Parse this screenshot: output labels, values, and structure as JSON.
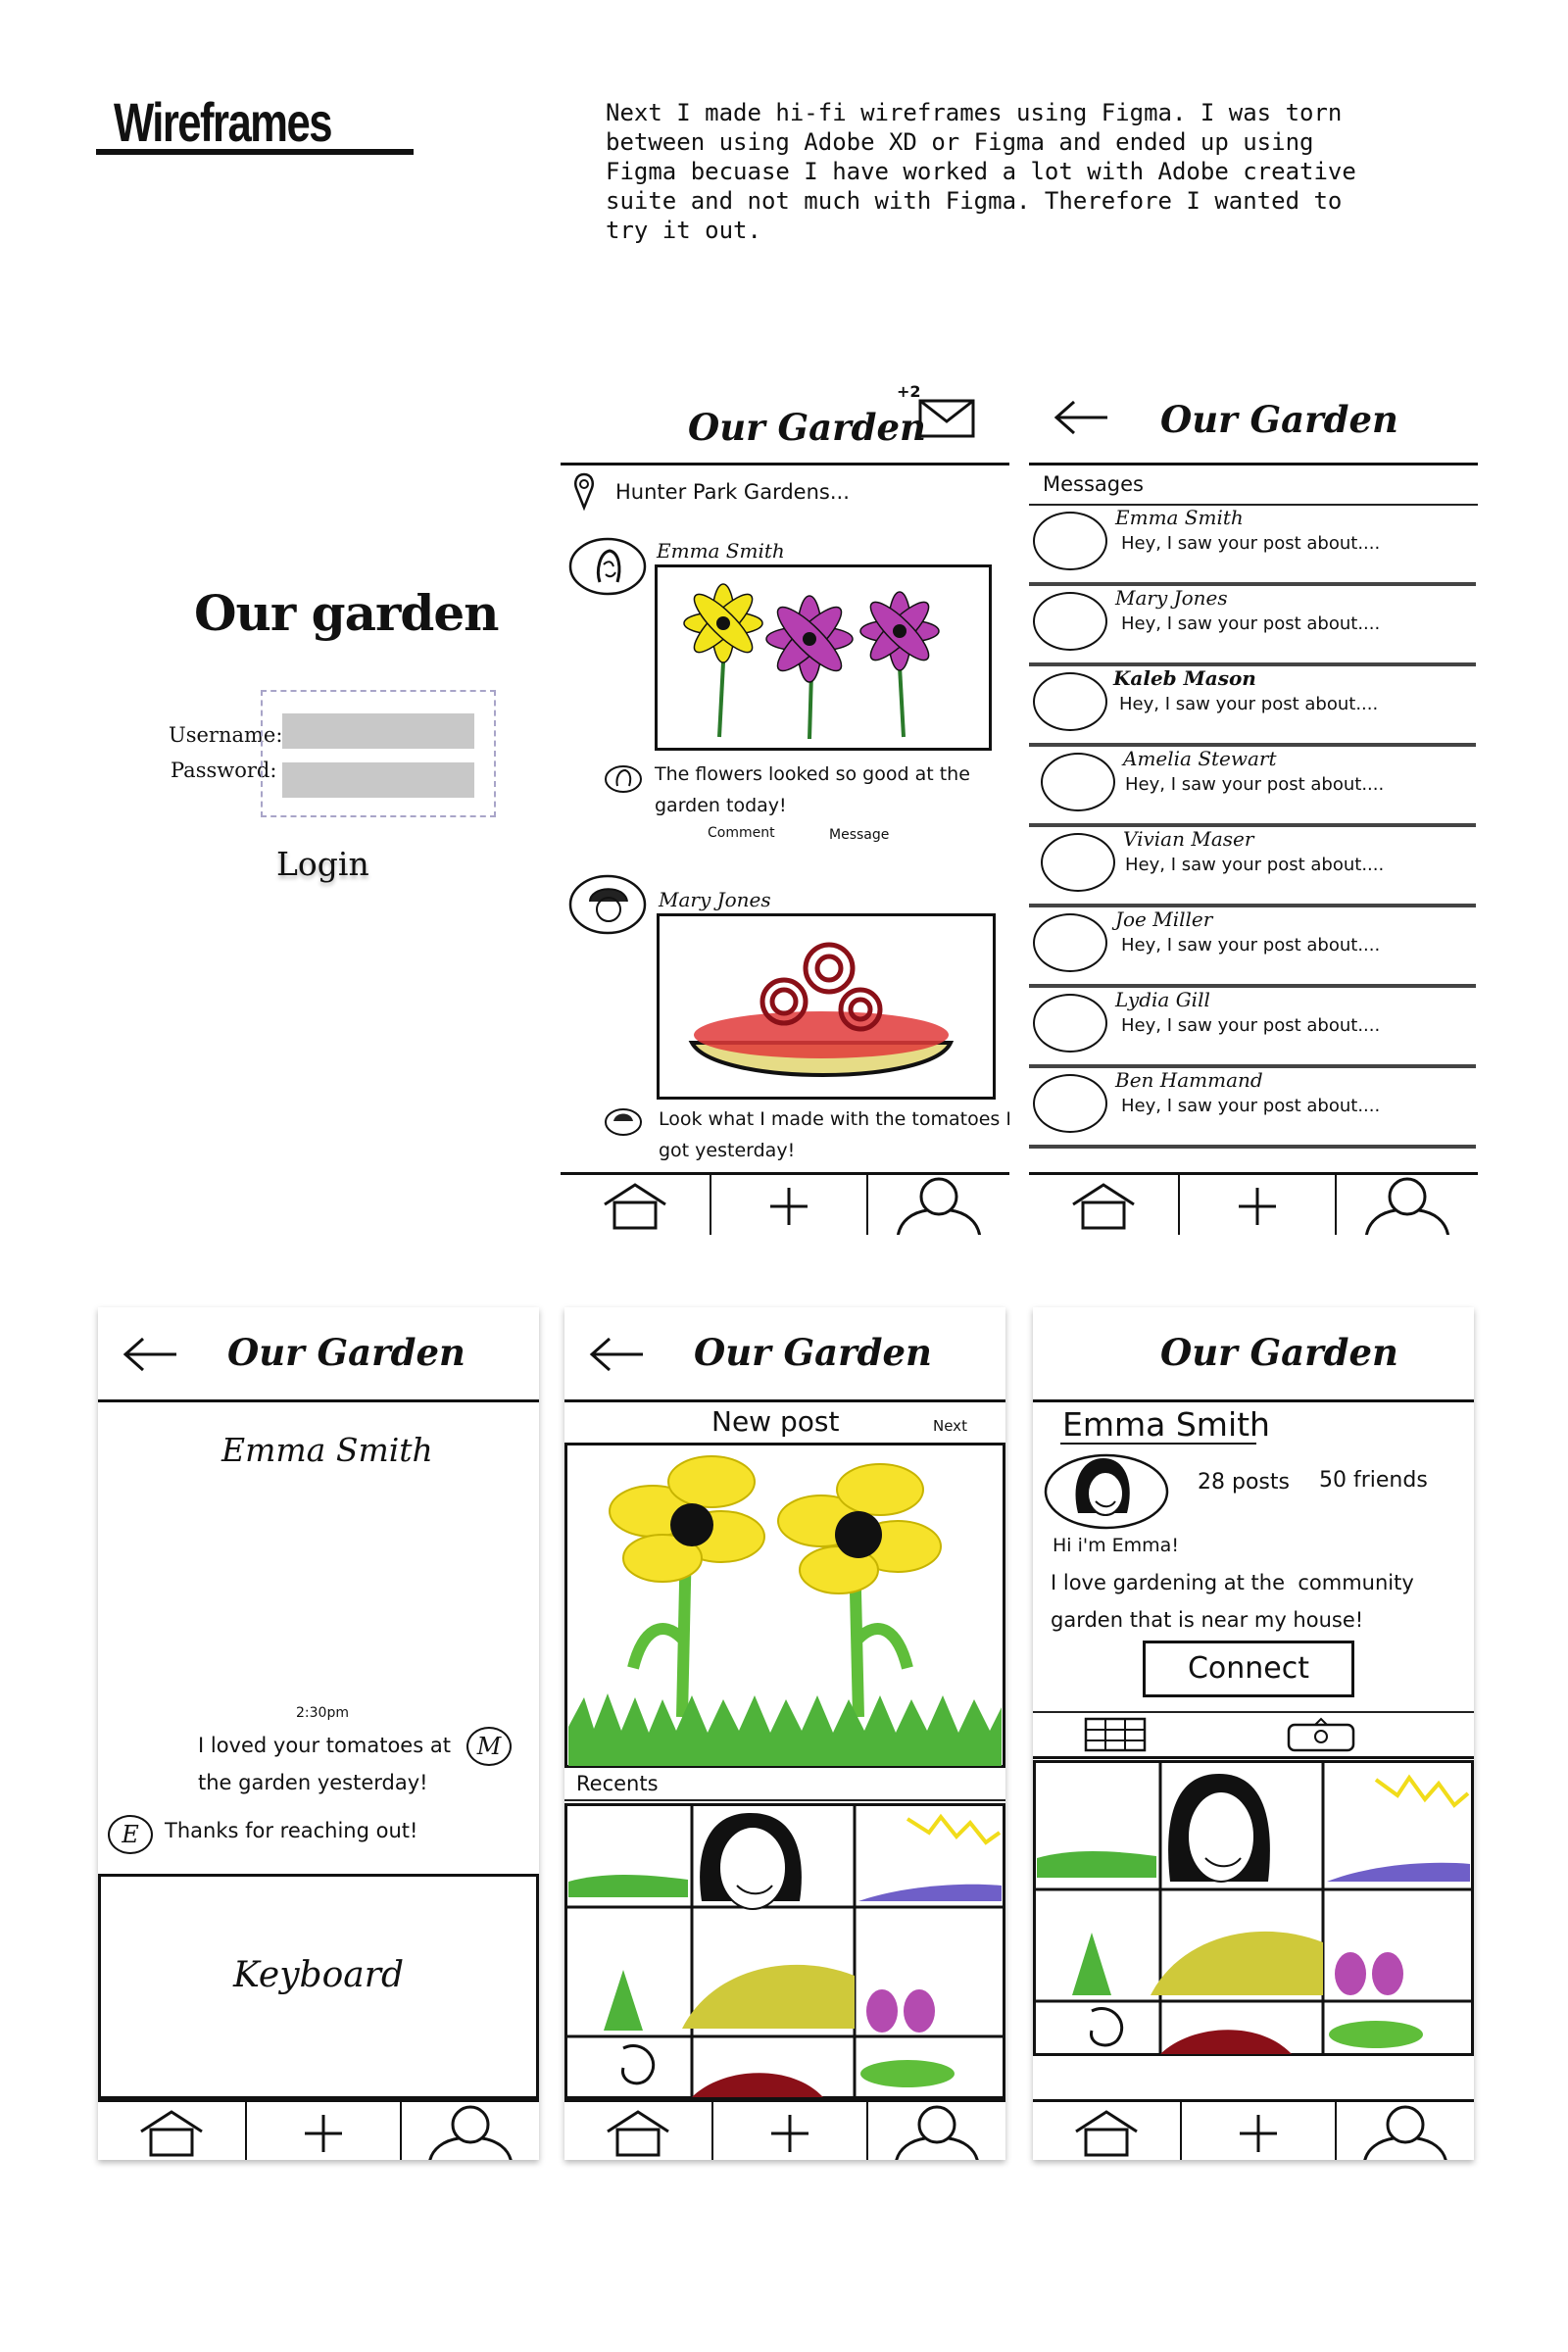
{
  "heading": "Wireframes",
  "intro_text": "Next I made hi-fi wireframes using Figma. I was torn\nbetween using Adobe XD or Figma and ended up using\nFigma becuase I have worked a lot with Adobe creative\nsuite and not much with Figma. Therefore I wanted to\ntry it out.",
  "login": {
    "title": "Our garden",
    "username_label": "Username:",
    "password_label": "Password:",
    "login_label": "Login"
  },
  "app_title": "Our Garden",
  "feed": {
    "notification_count": "+2",
    "location": "Hunter Park Gardens...",
    "posts": [
      {
        "author": "Emma Smith",
        "caption": "The flowers looked so good at the\ngarden today!",
        "comment_label": "Comment",
        "message_label": "Message"
      },
      {
        "author": "Mary Jones",
        "caption": "Look what I made with the tomatoes I\ngot yesterday!"
      }
    ]
  },
  "messages": {
    "header": "Messages",
    "items": [
      {
        "name": "Emma Smith",
        "preview": "Hey, I saw your post about...."
      },
      {
        "name": "Mary Jones",
        "preview": "Hey, I saw your post about...."
      },
      {
        "name": "Kaleb Mason",
        "preview": "Hey, I saw your post about...."
      },
      {
        "name": "Amelia Stewart",
        "preview": "Hey, I saw your post about...."
      },
      {
        "name": "Vivian Maser",
        "preview": "Hey, I saw your post about...."
      },
      {
        "name": "Joe Miller",
        "preview": "Hey, I saw your post about...."
      },
      {
        "name": "Lydia Gill",
        "preview": "Hey, I saw your post about...."
      },
      {
        "name": "Ben Hammand",
        "preview": "Hey, I saw your post about...."
      }
    ]
  },
  "chat": {
    "contact": "Emma Smith",
    "timestamp": "2:30pm",
    "received": "I loved your tomatoes at\nthe garden yesterday!",
    "received_initial": "M",
    "sent": "Thanks for reaching out!",
    "sent_initial": "E",
    "keyboard_label": "Keyboard"
  },
  "new_post": {
    "title": "New post",
    "next_label": "Next",
    "recents_label": "Recents"
  },
  "profile": {
    "name": "Emma Smith",
    "posts_count": "28 posts",
    "friends_count": "50 friends",
    "bio_line1": "Hi i'm Emma!",
    "bio_line2": "I love gardening at the  community\ngarden that is near my house!",
    "connect_label": "Connect"
  },
  "icons": [
    "home-icon",
    "plus-icon",
    "profile-icon",
    "back-arrow-icon",
    "envelope-icon",
    "location-pin-icon",
    "grid-icon",
    "tagged-icon"
  ],
  "colors": {
    "ink": "#111111",
    "field_gray": "#c8c8c8",
    "dashed_border": "#a8a4c8"
  }
}
